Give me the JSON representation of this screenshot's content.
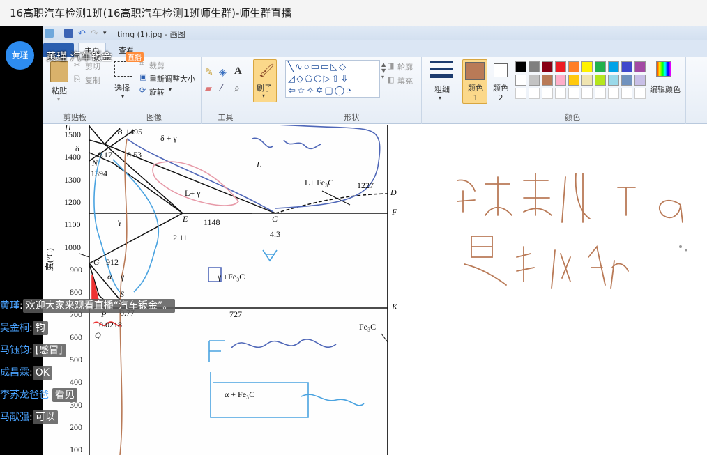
{
  "window": {
    "title": "16高职汽车检测1班(16高职汽车检测1班师生群)-师生群直播"
  },
  "live": {
    "avatar_text": "黄瑾",
    "streamer_title": "黄瑾 汽车钣金",
    "badge": "直播"
  },
  "paint": {
    "file_title": "timg (1).jpg - 画图",
    "tabs": [
      "主页",
      "查看"
    ],
    "clipboard": {
      "paste": "粘贴",
      "cut": "剪切",
      "copy": "复制",
      "label": "剪贴板"
    },
    "image": {
      "select": "选择",
      "crop": "裁剪",
      "resize": "重新调整大小",
      "rotate": "旋转",
      "label": "图像"
    },
    "tools_label": "工具",
    "brushes": "刷子",
    "shapes": {
      "outline": "轮廓",
      "fill": "填充",
      "label": "形状"
    },
    "size": "粗细",
    "color1": "颜色 1",
    "color2": "颜色 2",
    "edit_colors": "编辑颜色",
    "colors_label": "颜色",
    "palette_row1": [
      "#000000",
      "#7f7f7f",
      "#880015",
      "#ed1c24",
      "#ff7f27",
      "#fff200",
      "#22b14c",
      "#00a2e8",
      "#3f48cc",
      "#a349a4"
    ],
    "palette_row2": [
      "#ffffff",
      "#c3c3c3",
      "#b97a57",
      "#ffaec9",
      "#ffc90e",
      "#efe4b0",
      "#b5e61d",
      "#99d9ea",
      "#7092be",
      "#c8bfe7"
    ],
    "color1_value": "#b97a57",
    "color2_value": "#ffffff"
  },
  "diagram": {
    "y_ticks": [
      "1500",
      "1400",
      "1300",
      "1200",
      "1100",
      "1000",
      "900",
      "800",
      "700",
      "600",
      "500",
      "400",
      "300",
      "200",
      "100"
    ],
    "y_axis_label": "度(°C)",
    "labels": {
      "H": "H",
      "B": "B",
      "b1495": "1495",
      "dg": "δ + γ",
      "delta": "δ",
      "v017": "0.17",
      "v053": "0.53",
      "N": "N",
      "v1394": "1394",
      "L": "L",
      "Lg": "L+ γ",
      "LFe3C": "L+ Fe₃C",
      "v1227": "1227",
      "D": "D",
      "F": "F",
      "E": "E",
      "v1148": "1148",
      "C": "C",
      "v43": "4.3",
      "v211": "2.11",
      "gamma": "γ",
      "G": "G",
      "v912": "912",
      "ag": "α + γ",
      "gFe3C": "γ +Fe₃C",
      "S": "S",
      "K": "K",
      "P": "P",
      "v077": "0.77",
      "v0218": "0.0218",
      "Q": "Q",
      "v727": "727",
      "Fe3C": "Fe₃C",
      "aFe3C": "α + Fe₃C"
    }
  },
  "chat": [
    {
      "who": "黄瑾",
      "msg": "欢迎大家来观看直播“汽车钣金”。"
    },
    {
      "who": "吴金桐",
      "msg": "钧"
    },
    {
      "who": "马钰钧",
      "msg": "[感冒]"
    },
    {
      "who": "成昌霖",
      "msg": "OK"
    },
    {
      "who": "李苏龙爸爸",
      "msg": "看见"
    },
    {
      "who": "马献强",
      "msg": "可以"
    }
  ]
}
